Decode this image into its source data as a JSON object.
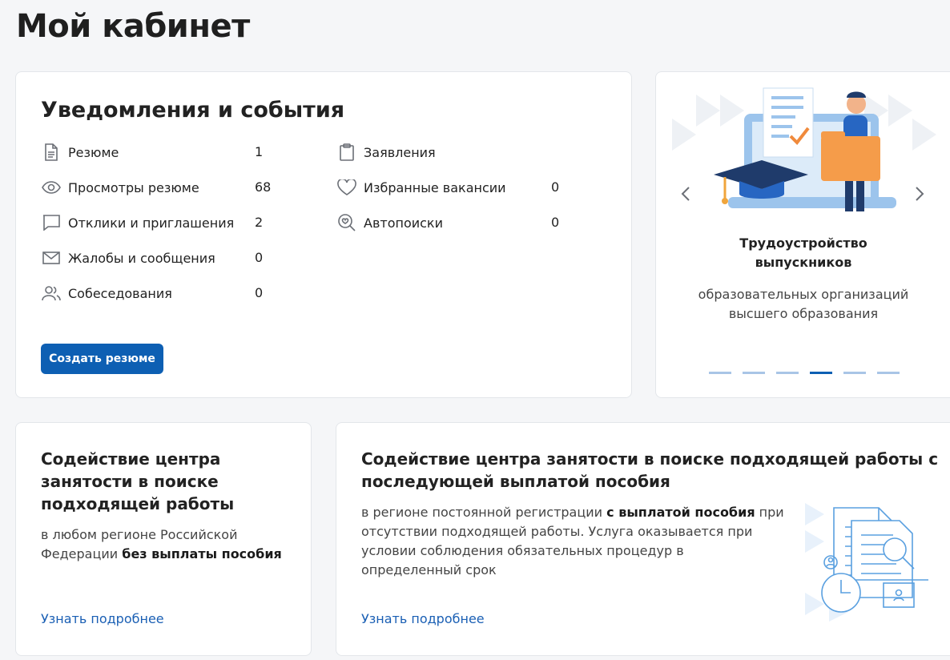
{
  "page": {
    "title": "Мой кабинет"
  },
  "notifications": {
    "title": "Уведомления и события",
    "left_items": [
      {
        "icon": "document-icon",
        "label": "Резюме",
        "count": "1"
      },
      {
        "icon": "eye-icon",
        "label": "Просмотры резюме",
        "count": "68"
      },
      {
        "icon": "chat-icon",
        "label": "Отклики и приглашения",
        "count": "2"
      },
      {
        "icon": "envelope-icon",
        "label": "Жалобы и сообщения",
        "count": "0"
      },
      {
        "icon": "users-icon",
        "label": "Собеседования",
        "count": "0"
      }
    ],
    "right_items": [
      {
        "icon": "clipboard-icon",
        "label": "Заявления",
        "count": ""
      },
      {
        "icon": "heart-icon",
        "label": "Избранные вакансии",
        "count": "0"
      },
      {
        "icon": "search-heart-icon",
        "label": "Автопоиски",
        "count": "0"
      }
    ],
    "create_button": "Создать резюме"
  },
  "promo": {
    "title_line1": "Трудоустройство",
    "title_line2": "выпускников",
    "desc_line1": "образовательных организаций",
    "desc_line2": "высшего образования",
    "active_slide": 3,
    "slide_count": 6
  },
  "services": [
    {
      "title_lines": [
        "Содействие центра",
        "занятости в поиске",
        "подходящей работы"
      ],
      "desc_line1": "в любом регионе Российской",
      "desc_line2_plain": "Федерации ",
      "desc_line2_bold": "без выплаты пособия",
      "link": "Узнать подробнее"
    },
    {
      "title_lines": [
        "Содействие центра занятости в поиске подходящей работы с",
        "последующей выплатой пособия"
      ],
      "desc_line1_plain": "в регионе постоянной регистрации ",
      "desc_line1_bold": "с выплатой пособия",
      "desc_line1_tail": " при",
      "desc_line2": "отсутствии подходящей работы. Услуга оказывается при",
      "desc_line3": "условии соблюдения обязательных процедур в",
      "desc_line4": "определенный срок",
      "link": "Узнать подробнее"
    }
  ],
  "colors": {
    "primary": "#0d5fb3",
    "link": "#1a5fb4",
    "background": "#f5f6f8"
  }
}
